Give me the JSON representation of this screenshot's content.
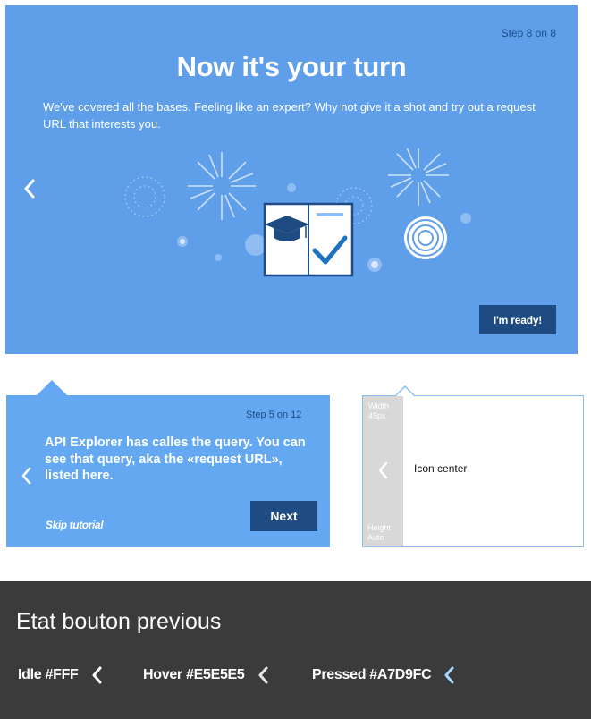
{
  "hero": {
    "step": "Step 8 on 8",
    "title": "Now it's your turn",
    "body": "We've covered all the bases. Feeling like an expert? Why not give it a shot and try out a request URL that interests you.",
    "prev_icon": "chevron-left-icon",
    "illustration_icon": "graduation-book-fireworks-illustration",
    "ready_label": "I'm ready!",
    "colors": {
      "background": "#5F9FEA",
      "button": "#1E4B82"
    }
  },
  "tooltip": {
    "step": "Step 5 on 12",
    "body": "API Explorer has calles the query. You can see that query, aka the «request URL», listed here.",
    "skip_label": "Skip tutorial",
    "next_label": "Next",
    "prev_icon": "chevron-left-icon",
    "colors": {
      "background": "#64A8F2",
      "button": "#1E4B82"
    }
  },
  "spec": {
    "width_label": "Width\n45px",
    "height_label": "Height\nAuto",
    "icon_label": "Icon center",
    "icon": "chevron-left-icon"
  },
  "states_panel": {
    "title": "Etat bouton previous",
    "states": [
      {
        "label": "Idle #FFF",
        "color": "#FFFFFF"
      },
      {
        "label": "Hover #E5E5E5",
        "color": "#E5E5E5"
      },
      {
        "label": "Pressed #A7D9FC",
        "color": "#A7D9FC"
      }
    ]
  }
}
